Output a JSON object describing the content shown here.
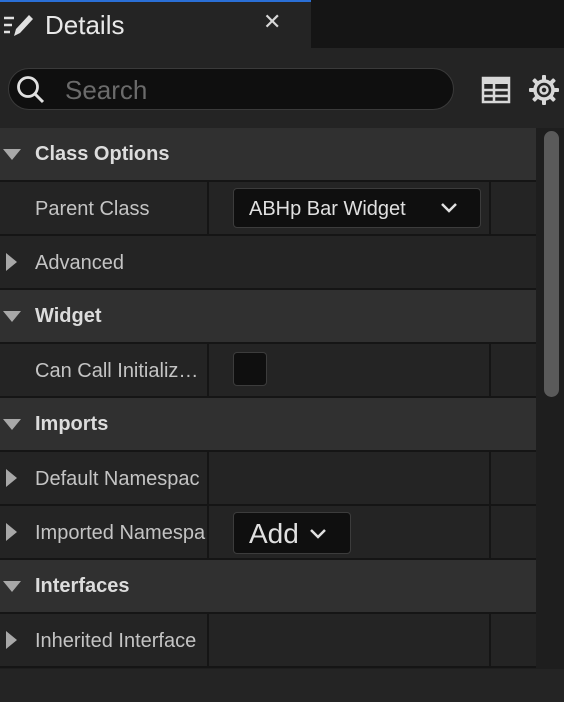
{
  "tab": {
    "title": "Details",
    "close": "✕"
  },
  "search": {
    "placeholder": "Search",
    "value": ""
  },
  "toolbar": {
    "icons": [
      "table-view-icon",
      "settings-gear-icon"
    ]
  },
  "sections": {
    "class_options": {
      "label": "Class Options",
      "parent_class": {
        "label": "Parent Class",
        "value": "ABHp Bar Widget"
      },
      "advanced": {
        "label": "Advanced"
      }
    },
    "widget": {
      "label": "Widget",
      "can_call_initialize": {
        "label": "Can Call Initializ…",
        "checked": false
      }
    },
    "imports": {
      "label": "Imports",
      "default_namespaces": {
        "label": "Default Namespac"
      },
      "imported_namespaces": {
        "label": "Imported Namespa",
        "button": "Add"
      }
    },
    "interfaces": {
      "label": "Interfaces",
      "inherited_interfaces": {
        "label": "Inherited Interface"
      }
    }
  },
  "colors": {
    "accent": "#2a6fd6",
    "panel_bg": "#242424",
    "category_bg": "#303030"
  }
}
